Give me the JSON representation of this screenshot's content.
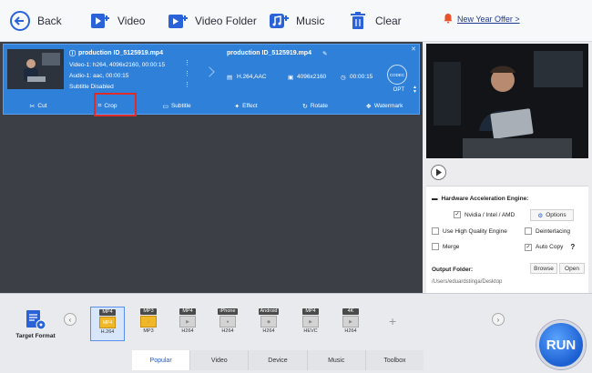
{
  "toolbar": {
    "back_label": "Back",
    "video_label": "Video",
    "video_folder_label": "Video Folder",
    "music_label": "Music",
    "clear_label": "Clear",
    "offer_label": "New Year Offer >"
  },
  "file": {
    "source_name": "production ID_5125919.mp4",
    "video_info": "Video-1: h264, 4096x2160, 00:00:15",
    "audio_info": "Audio-1: aac, 00:00:15",
    "subtitle_info": "Subtitle Disabled",
    "output_name": "production ID_5125919.mp4",
    "output_codec": "H.264,AAC",
    "output_resolution": "4096x2160",
    "output_duration": "00:00:15",
    "opt_label": "OPT",
    "codec_badge": "CODEC"
  },
  "edit_bar": {
    "cut": "Cut",
    "crop": "Crop",
    "subtitle": "Subtitle",
    "effect": "Effect",
    "rotate": "Rotate",
    "watermark": "Watermark"
  },
  "settings": {
    "hw_title": "Hardware Acceleration Engine:",
    "nvidia_label": "Nvidia / Intel / AMD",
    "nvidia_checked": true,
    "options_label": "Options",
    "hq_label": "Use High Quality Engine",
    "deint_label": "Deinterlacing",
    "merge_label": "Merge",
    "autocopy_label": "Auto Copy",
    "autocopy_checked": true,
    "help": "?",
    "output_folder_label": "Output Folder:",
    "browse_label": "Browse",
    "open_label": "Open",
    "output_path": "/Users/eduardstinga/Desktop"
  },
  "bottom": {
    "target_format_label": "Target Format",
    "formats": [
      {
        "head": "MP4",
        "body": "MP4",
        "label": "H.264",
        "selected": true
      },
      {
        "head": "MP3",
        "body": "",
        "label": "MP3",
        "selected": false
      },
      {
        "head": "MP4",
        "body": "",
        "label": "H264",
        "selected": false
      },
      {
        "head": "iPhone",
        "body": "",
        "label": "H264",
        "selected": false
      },
      {
        "head": "Android",
        "body": "",
        "label": "H264",
        "selected": false
      },
      {
        "head": "MP4",
        "body": "",
        "label": "HEVC",
        "selected": false
      },
      {
        "head": "4K",
        "body": "",
        "label": "H264",
        "selected": false
      }
    ],
    "tabs": [
      "Popular",
      "Video",
      "Device",
      "Music",
      "Toolbox"
    ],
    "active_tab": "Popular",
    "run_label": "RUN"
  },
  "colors": {
    "accent": "#2f80d9",
    "highlight": "#e02b2b",
    "run": "#1b5fd1"
  }
}
